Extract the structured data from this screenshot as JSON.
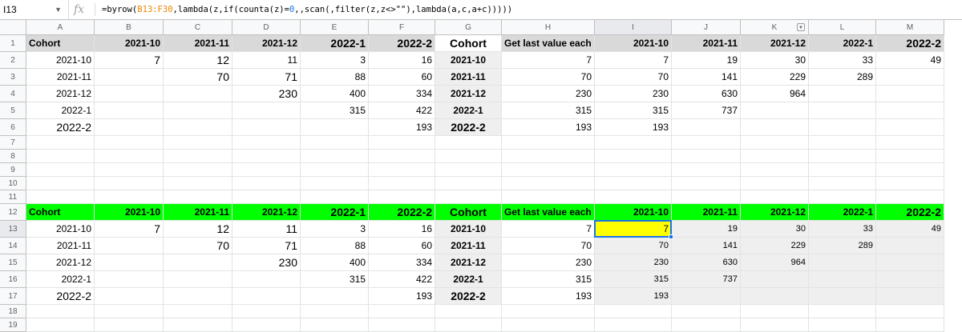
{
  "formula_bar": {
    "name_box": "I13",
    "fx": "fx",
    "formula_parts": [
      {
        "t": "=byrow(",
        "k": "plain"
      },
      {
        "t": "B13:F30",
        "k": "ref"
      },
      {
        "t": ",lambda(z,if(counta(z)=",
        "k": "plain"
      },
      {
        "t": "0",
        "k": "num"
      },
      {
        "t": ",,scan(,filter(z,z<>\"\"),lambda(a,c,a+c)))))",
        "k": "plain"
      }
    ]
  },
  "columns": [
    "A",
    "B",
    "C",
    "D",
    "E",
    "F",
    "G",
    "H",
    "I",
    "J",
    "K",
    "L",
    "M"
  ],
  "selected_column": "I",
  "selected_row": 13,
  "rows": {
    "1": [
      [
        "Cohort",
        "l b"
      ],
      [
        "2021-10",
        "r b"
      ],
      [
        "2021-11",
        "r b"
      ],
      [
        "2021-12",
        "r b"
      ],
      [
        "2022-1",
        "r b big"
      ],
      [
        "2022-2",
        "r b big"
      ],
      [
        "Cohort",
        "c b big"
      ],
      [
        "Get last value each co",
        "l b"
      ],
      [
        "2021-10",
        "r b"
      ],
      [
        "2021-11",
        "r b"
      ],
      [
        "2021-12",
        "r b"
      ],
      [
        "2022-1",
        "r b"
      ],
      [
        "2022-2",
        "r b big"
      ]
    ],
    "2": [
      [
        "2021-10",
        "r"
      ],
      [
        "7",
        "r big"
      ],
      [
        "12",
        "r big"
      ],
      [
        "11",
        "r"
      ],
      [
        "3",
        "r"
      ],
      [
        "16",
        "r"
      ],
      [
        "2021-10",
        "c b"
      ],
      [
        "7",
        "r"
      ],
      [
        "7",
        "r"
      ],
      [
        "19",
        "r"
      ],
      [
        "30",
        "r"
      ],
      [
        "33",
        "r"
      ],
      [
        "49",
        "r"
      ]
    ],
    "3": [
      [
        "2021-11",
        "r"
      ],
      [
        "",
        ""
      ],
      [
        "70",
        "r big"
      ],
      [
        "71",
        "r big"
      ],
      [
        "88",
        "r"
      ],
      [
        "60",
        "r"
      ],
      [
        "2021-11",
        "c b"
      ],
      [
        "70",
        "r"
      ],
      [
        "70",
        "r"
      ],
      [
        "141",
        "r"
      ],
      [
        "229",
        "r"
      ],
      [
        "289",
        "r"
      ],
      [
        "",
        ""
      ]
    ],
    "4": [
      [
        "2021-12",
        "r"
      ],
      [
        "",
        ""
      ],
      [
        "",
        ""
      ],
      [
        "230",
        "r big"
      ],
      [
        "400",
        "r"
      ],
      [
        "334",
        "r"
      ],
      [
        "2021-12",
        "c b"
      ],
      [
        "230",
        "r"
      ],
      [
        "230",
        "r"
      ],
      [
        "630",
        "r"
      ],
      [
        "964",
        "r"
      ],
      [
        "",
        ""
      ],
      [
        "",
        ""
      ]
    ],
    "5": [
      [
        "2022-1",
        "r"
      ],
      [
        "",
        ""
      ],
      [
        "",
        ""
      ],
      [
        "",
        ""
      ],
      [
        "315",
        "r"
      ],
      [
        "422",
        "r"
      ],
      [
        "2022-1",
        "c b"
      ],
      [
        "315",
        "r"
      ],
      [
        "315",
        "r"
      ],
      [
        "737",
        "r"
      ],
      [
        "",
        ""
      ],
      [
        "",
        ""
      ],
      [
        "",
        ""
      ]
    ],
    "6": [
      [
        "2022-2",
        "r big"
      ],
      [
        "",
        ""
      ],
      [
        "",
        ""
      ],
      [
        "",
        ""
      ],
      [
        "",
        ""
      ],
      [
        "193",
        "r"
      ],
      [
        "2022-2",
        "c b big"
      ],
      [
        "193",
        "r"
      ],
      [
        "193",
        "r"
      ],
      [
        "",
        ""
      ],
      [
        "",
        ""
      ],
      [
        "",
        ""
      ],
      [
        "",
        ""
      ]
    ],
    "12": [
      [
        "Cohort",
        "l b"
      ],
      [
        "2021-10",
        "r b"
      ],
      [
        "2021-11",
        "r b"
      ],
      [
        "2021-12",
        "r b"
      ],
      [
        "2022-1",
        "r b big"
      ],
      [
        "2022-2",
        "r b big"
      ],
      [
        "Cohort",
        "c b big"
      ],
      [
        "Get last value each co",
        "l b"
      ],
      [
        "2021-10",
        "r b"
      ],
      [
        "2021-11",
        "r b"
      ],
      [
        "2021-12",
        "r b"
      ],
      [
        "2022-1",
        "r b"
      ],
      [
        "2022-2",
        "r b big"
      ]
    ],
    "13": [
      [
        "2021-10",
        "r"
      ],
      [
        "7",
        "r big"
      ],
      [
        "12",
        "r big"
      ],
      [
        "11",
        "r big"
      ],
      [
        "3",
        "r"
      ],
      [
        "16",
        "r"
      ],
      [
        "2021-10",
        "c b"
      ],
      [
        "7",
        "r"
      ],
      [
        "7",
        "r"
      ],
      [
        "19",
        "r small"
      ],
      [
        "30",
        "r small"
      ],
      [
        "33",
        "r small"
      ],
      [
        "49",
        "r small"
      ]
    ],
    "14": [
      [
        "2021-11",
        "r"
      ],
      [
        "",
        ""
      ],
      [
        "70",
        "r big"
      ],
      [
        "71",
        "r big"
      ],
      [
        "88",
        "r"
      ],
      [
        "60",
        "r"
      ],
      [
        "2021-11",
        "c b"
      ],
      [
        "70",
        "r"
      ],
      [
        "70",
        "r small"
      ],
      [
        "141",
        "r small"
      ],
      [
        "229",
        "r small"
      ],
      [
        "289",
        "r small"
      ],
      [
        "",
        ""
      ]
    ],
    "15": [
      [
        "2021-12",
        "r"
      ],
      [
        "",
        ""
      ],
      [
        "",
        ""
      ],
      [
        "230",
        "r big"
      ],
      [
        "400",
        "r"
      ],
      [
        "334",
        "r"
      ],
      [
        "2021-12",
        "c b"
      ],
      [
        "230",
        "r"
      ],
      [
        "230",
        "r small"
      ],
      [
        "630",
        "r small"
      ],
      [
        "964",
        "r small"
      ],
      [
        "",
        ""
      ],
      [
        "",
        ""
      ]
    ],
    "16": [
      [
        "2022-1",
        "r"
      ],
      [
        "",
        ""
      ],
      [
        "",
        ""
      ],
      [
        "",
        ""
      ],
      [
        "315",
        "r"
      ],
      [
        "422",
        "r"
      ],
      [
        "2022-1",
        "c b"
      ],
      [
        "315",
        "r"
      ],
      [
        "315",
        "r small"
      ],
      [
        "737",
        "r small"
      ],
      [
        "",
        ""
      ],
      [
        "",
        ""
      ],
      [
        "",
        ""
      ]
    ],
    "17": [
      [
        "2022-2",
        "r big"
      ],
      [
        "",
        ""
      ],
      [
        "",
        ""
      ],
      [
        "",
        ""
      ],
      [
        "",
        ""
      ],
      [
        "193",
        "r"
      ],
      [
        "2022-2",
        "c b big"
      ],
      [
        "193",
        "r"
      ],
      [
        "193",
        "r small"
      ],
      [
        "",
        ""
      ],
      [
        "",
        ""
      ],
      [
        "",
        ""
      ],
      [
        "",
        ""
      ]
    ]
  },
  "row_numbers": [
    1,
    2,
    3,
    4,
    5,
    6,
    7,
    8,
    9,
    10,
    11,
    12,
    13,
    14,
    15,
    16,
    17,
    18,
    19
  ],
  "colors": {
    "header_gray": "#d9d9d9",
    "header_green": "#00ff00",
    "selected_fill": "#ffff00",
    "output_gray": "#efefef",
    "selection_border": "#1a73e8"
  }
}
